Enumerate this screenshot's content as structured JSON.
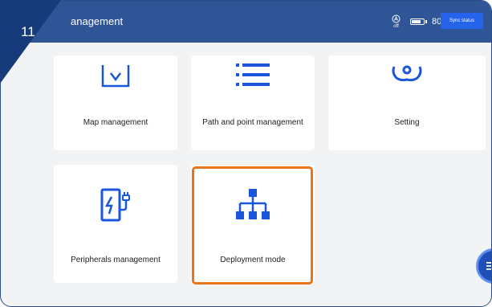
{
  "step": "11",
  "header": {
    "title": "anagement",
    "ai_status": "off",
    "battery": "80%",
    "battery_level": 0.8,
    "sync_label": "Sync status"
  },
  "cards": {
    "map": "Map management",
    "path": "Path and point management",
    "setting": "Setting",
    "peripherals": "Peripherals management",
    "deployment": "Deployment mode"
  },
  "colors": {
    "header": "#2f5597",
    "accent": "#2563eb",
    "highlight": "#e8741c",
    "icon": "#1a56db"
  },
  "icons": [
    "ai-off-icon",
    "battery-icon",
    "map-icon",
    "list-icon",
    "gear-icon",
    "charging-station-icon",
    "hierarchy-icon",
    "menu-icon"
  ]
}
